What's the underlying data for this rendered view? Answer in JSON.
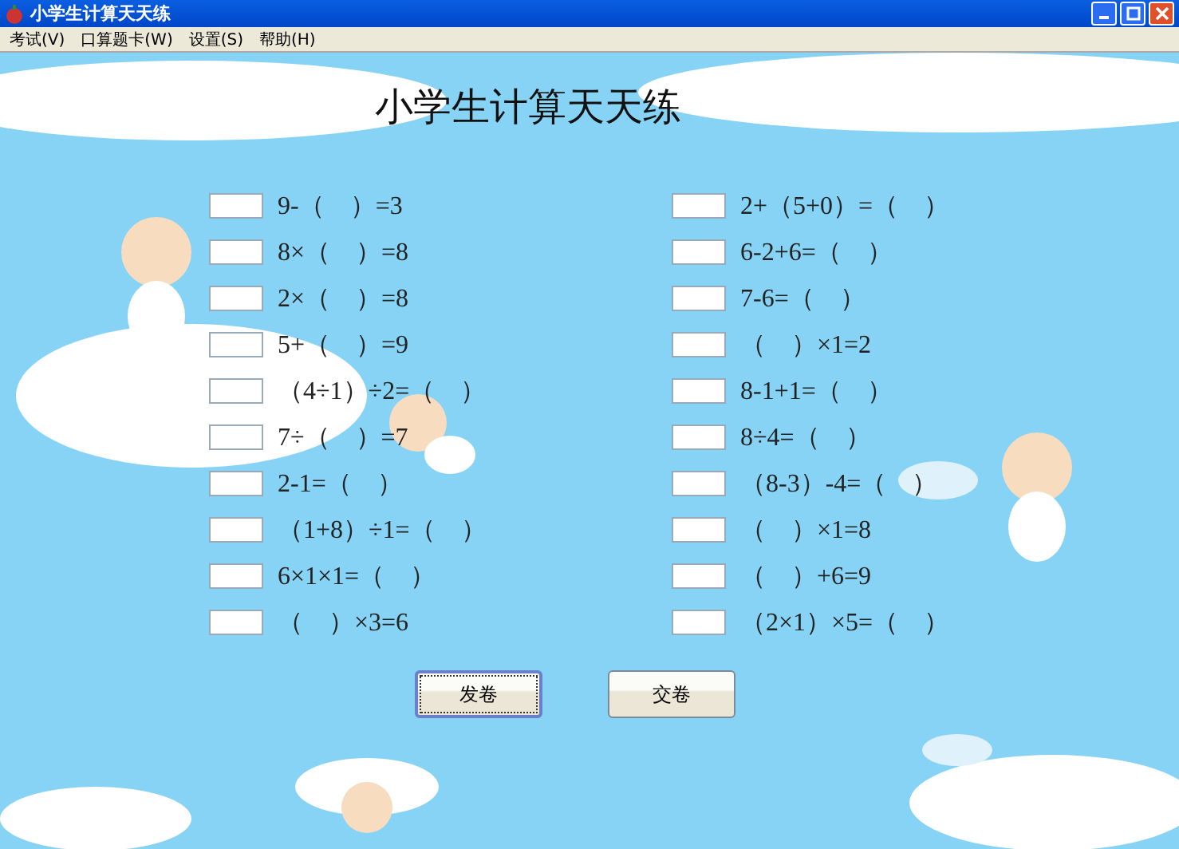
{
  "window": {
    "title": "小学生计算天天练"
  },
  "menu": [
    "考试(V)",
    "口算题卡(W)",
    "设置(S)",
    "帮助(H)"
  ],
  "heading": "小学生计算天天练",
  "problems_left": [
    {
      "question": "9-（　）=3"
    },
    {
      "question": "8×（　）=8"
    },
    {
      "question": "2×（　）=8"
    },
    {
      "question": "5+（　）=9"
    },
    {
      "question": "（4÷1）÷2=（　）"
    },
    {
      "question": "7÷（　）=7"
    },
    {
      "question": "2-1=（　）"
    },
    {
      "question": "（1+8）÷1=（　）"
    },
    {
      "question": "6×1×1=（　）"
    },
    {
      "question": "（　）×3=6"
    }
  ],
  "problems_right": [
    {
      "question": "2+（5+0）=（　）"
    },
    {
      "question": "6-2+6=（　）"
    },
    {
      "question": "7-6=（　）"
    },
    {
      "question": "（　）×1=2"
    },
    {
      "question": "8-1+1=（　）"
    },
    {
      "question": "8÷4=（　）"
    },
    {
      "question": "（8-3）-4=（　）"
    },
    {
      "question": "（　）×1=8"
    },
    {
      "question": "（　）+6=9"
    },
    {
      "question": "（2×1）×5=（　）"
    }
  ],
  "buttons": [
    {
      "label": "发卷",
      "focused": true
    },
    {
      "label": "交卷",
      "focused": false
    }
  ]
}
